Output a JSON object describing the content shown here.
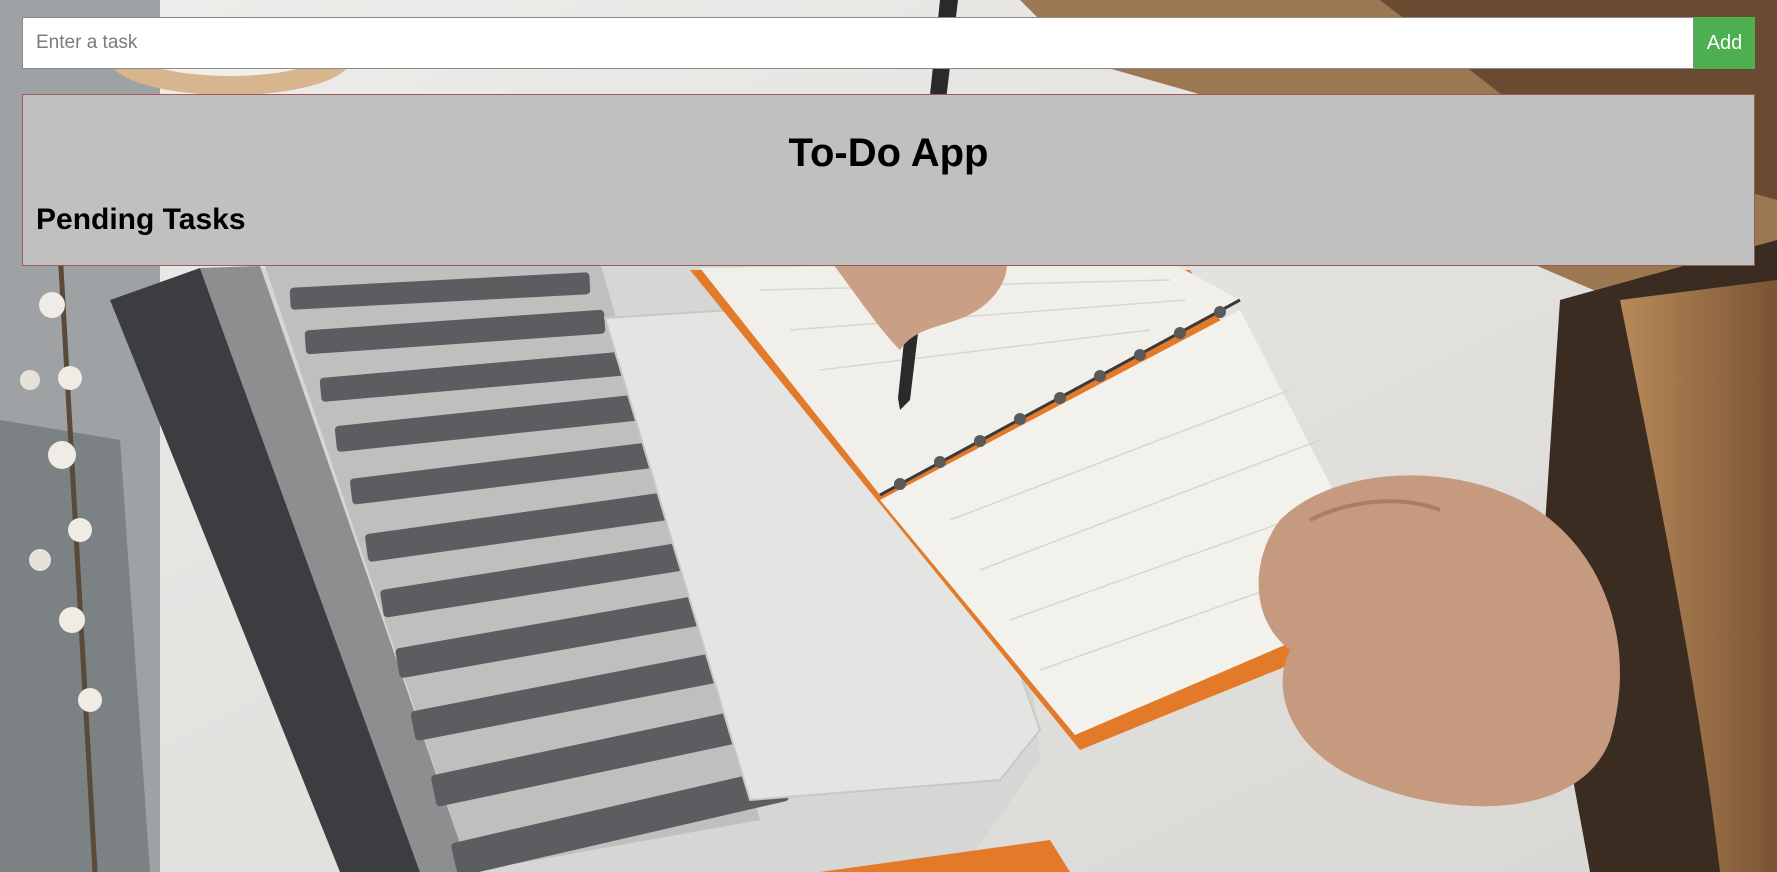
{
  "task_form": {
    "input_placeholder": "Enter a task",
    "input_value": "",
    "add_label": "Add"
  },
  "app": {
    "title": "To-Do App",
    "pending_heading": "Pending Tasks",
    "pending_tasks": []
  },
  "colors": {
    "add_button": "#4caf50",
    "panel_background": "#c0c0c0",
    "panel_border": "#9a5a55"
  }
}
